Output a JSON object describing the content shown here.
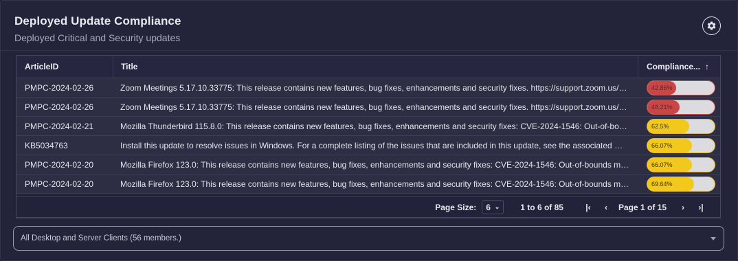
{
  "widget": {
    "title": "Deployed Update Compliance",
    "subtitle": "Deployed Critical and Security updates"
  },
  "icons": {
    "settings": "gear-icon"
  },
  "colors": {
    "low": "#c94646",
    "mid": "#f2c81d",
    "track": "#dcdce0"
  },
  "table": {
    "columns": [
      "ArticleID",
      "Title",
      "Compliance..."
    ],
    "sort": "ascending",
    "rows": [
      {
        "article_id": "PMPC-2024-02-26",
        "title": "Zoom Meetings 5.17.10.33775: This release contains new features, bug fixes, enhancements and security fixes. https://support.zoom.us/hc/...",
        "compliance_label": "42.86%",
        "compliance_value": 42.86,
        "level": "low"
      },
      {
        "article_id": "PMPC-2024-02-26",
        "title": "Zoom Meetings 5.17.10.33775: This release contains new features, bug fixes, enhancements and security fixes. https://support.zoom.us/hc/...",
        "compliance_label": "48.21%",
        "compliance_value": 48.21,
        "level": "low"
      },
      {
        "article_id": "PMPC-2024-02-21",
        "title": "Mozilla Thunderbird 115.8.0: This release contains new features, bug fixes, enhancements and security fixes: CVE-2024-1546: Out-of-boun...",
        "compliance_label": "62.5%",
        "compliance_value": 62.5,
        "level": "mid"
      },
      {
        "article_id": "KB5034763",
        "title": "Install this update to resolve issues in Windows. For a complete listing of the issues that are included in this update, see the associated Mic...",
        "compliance_label": "66.07%",
        "compliance_value": 66.07,
        "level": "mid"
      },
      {
        "article_id": "PMPC-2024-02-20",
        "title": "Mozilla Firefox 123.0: This release contains new features, bug fixes, enhancements and security fixes: CVE-2024-1546: Out-of-bounds mem...",
        "compliance_label": "66.07%",
        "compliance_value": 66.07,
        "level": "mid"
      },
      {
        "article_id": "PMPC-2024-02-20",
        "title": "Mozilla Firefox 123.0: This release contains new features, bug fixes, enhancements and security fixes: CVE-2024-1546: Out-of-bounds mem...",
        "compliance_label": "69.64%",
        "compliance_value": 69.64,
        "level": "mid"
      }
    ]
  },
  "pager": {
    "page_size_label": "Page Size:",
    "page_size": "6",
    "range": "1 to 6 of 85",
    "page_indicator": "Page 1 of 15",
    "first": "|<",
    "prev": "<",
    "next": ">",
    "last": ">|"
  },
  "collection": {
    "selected": "All Desktop and Server Clients (56 members.)"
  }
}
